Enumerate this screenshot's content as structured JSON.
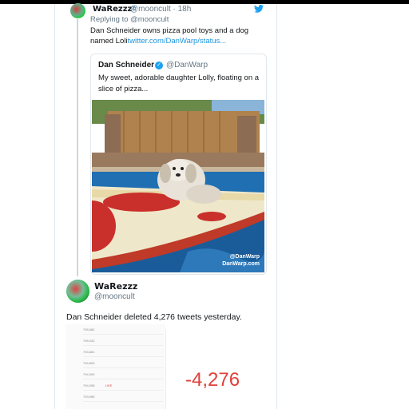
{
  "tweet1": {
    "display_name": "WaRezzz",
    "name_suffix": "z",
    "handle_time": "@mooncult · 18h",
    "replying_to": "Replying to @mooncult",
    "text_plain": "Dan Schneider owns pizza pool toys and a dog named Loli",
    "text_link": "twitter.com/DanWarp/status..."
  },
  "quoted_tweet": {
    "display_name": "Dan Schneider",
    "handle": "@DanWarp",
    "text": "My sweet, adorable daughter Lolly, floating on a slice of pizza...",
    "watermark_line1": "@DanWarp",
    "watermark_line2": "DanWarp.com"
  },
  "tweet2": {
    "display_name": "WaRezzz",
    "handle": "@mooncult",
    "text": "Dan Schneider deleted 4,276 tweets yesterday."
  },
  "stats_image": {
    "big_number": "-4,276",
    "rows": [
      "795,082",
      "795,032",
      "794,861",
      "794,809",
      "794,309",
      "794,058",
      "793,985"
    ],
    "live_label": "LIVE"
  },
  "colors": {
    "link_blue": "#1b95e0",
    "verified_blue": "#1da1f2",
    "negative_red": "#e0403a"
  }
}
